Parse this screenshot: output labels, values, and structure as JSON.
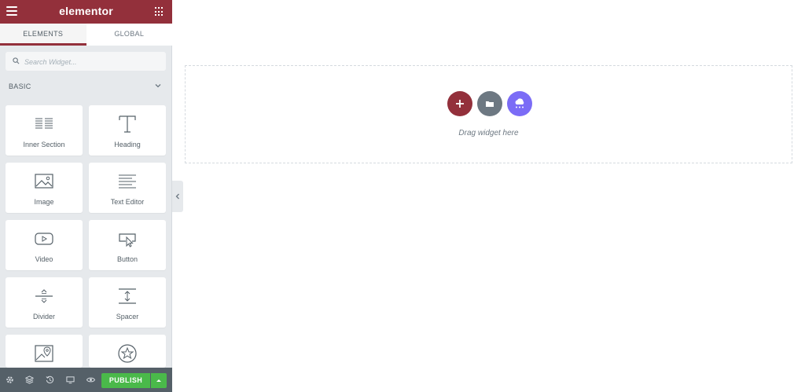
{
  "topbar": {
    "logo": "elementor",
    "menu_icon": "hamburger-icon",
    "apps_icon": "grid-icon",
    "brand_color": "#93303b"
  },
  "tabs": [
    {
      "label": "ELEMENTS",
      "active": true
    },
    {
      "label": "GLOBAL",
      "active": false
    }
  ],
  "search": {
    "placeholder": "Search Widget..."
  },
  "category": {
    "label": "BASIC",
    "expanded": true
  },
  "widgets": [
    {
      "label": "Inner Section",
      "icon": "inner-section-icon"
    },
    {
      "label": "Heading",
      "icon": "heading-icon"
    },
    {
      "label": "Image",
      "icon": "image-icon"
    },
    {
      "label": "Text Editor",
      "icon": "text-editor-icon"
    },
    {
      "label": "Video",
      "icon": "video-icon"
    },
    {
      "label": "Button",
      "icon": "button-icon"
    },
    {
      "label": "Divider",
      "icon": "divider-icon"
    },
    {
      "label": "Spacer",
      "icon": "spacer-icon"
    },
    {
      "label": "",
      "icon": "google-maps-icon"
    },
    {
      "label": "",
      "icon": "star-icon"
    }
  ],
  "bottombar": {
    "publish_label": "PUBLISH",
    "publish_color": "#4ab94a"
  },
  "canvas": {
    "drag_text": "Drag widget here",
    "add_color": "#93303b",
    "template_color": "#6d7882",
    "cloud_color": "#7b6cf6"
  }
}
